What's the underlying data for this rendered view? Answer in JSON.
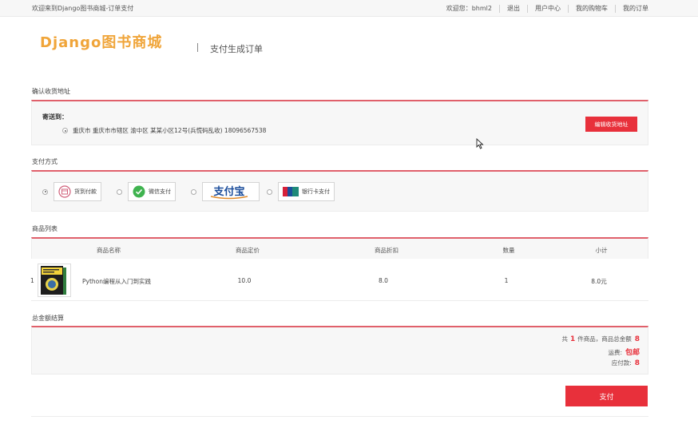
{
  "topbar": {
    "welcome": "欢迎来到Django图书商城-订单支付",
    "greeting": "欢迎您：bhml2",
    "links": [
      "退出",
      "用户中心",
      "我的购物车",
      "我的订单"
    ]
  },
  "header": {
    "logo": "Django图书商城",
    "subtitle": "支付生成订单"
  },
  "address": {
    "section_title": "确认收货地址",
    "label": "寄送到：",
    "text": "重庆市 重庆市市辖区 渝中区 某某小区12号(兵慌码乱收) 18096567538",
    "edit_button": "编辑收货地址"
  },
  "payment": {
    "section_title": "支付方式",
    "options": [
      "货到付款",
      "微信支付",
      "支付宝",
      "银行卡支付"
    ],
    "selected": "货到付款"
  },
  "goods": {
    "section_title": "商品列表",
    "headers": [
      "商品名称",
      "商品定价",
      "商品折扣",
      "数量",
      "小计"
    ],
    "rows": [
      {
        "index": "1",
        "name": "Python编程从入门到实践",
        "price": "10.0",
        "discount": "8.0",
        "quantity": "1",
        "subtotal": "8.0元"
      }
    ]
  },
  "total": {
    "section_title": "总金额结算",
    "line1_prefix": "共",
    "count": "1",
    "line1_middle": "件商品，商品总金额",
    "amount": "8",
    "shipping_label": "运费:",
    "shipping_value": "包邮",
    "payable_label": "应付款:",
    "payable_value": "8"
  },
  "pay_button": "支付",
  "colors": {
    "accent": "#e8303b",
    "logo": "#f0a53a",
    "divider": "#e0606b"
  }
}
